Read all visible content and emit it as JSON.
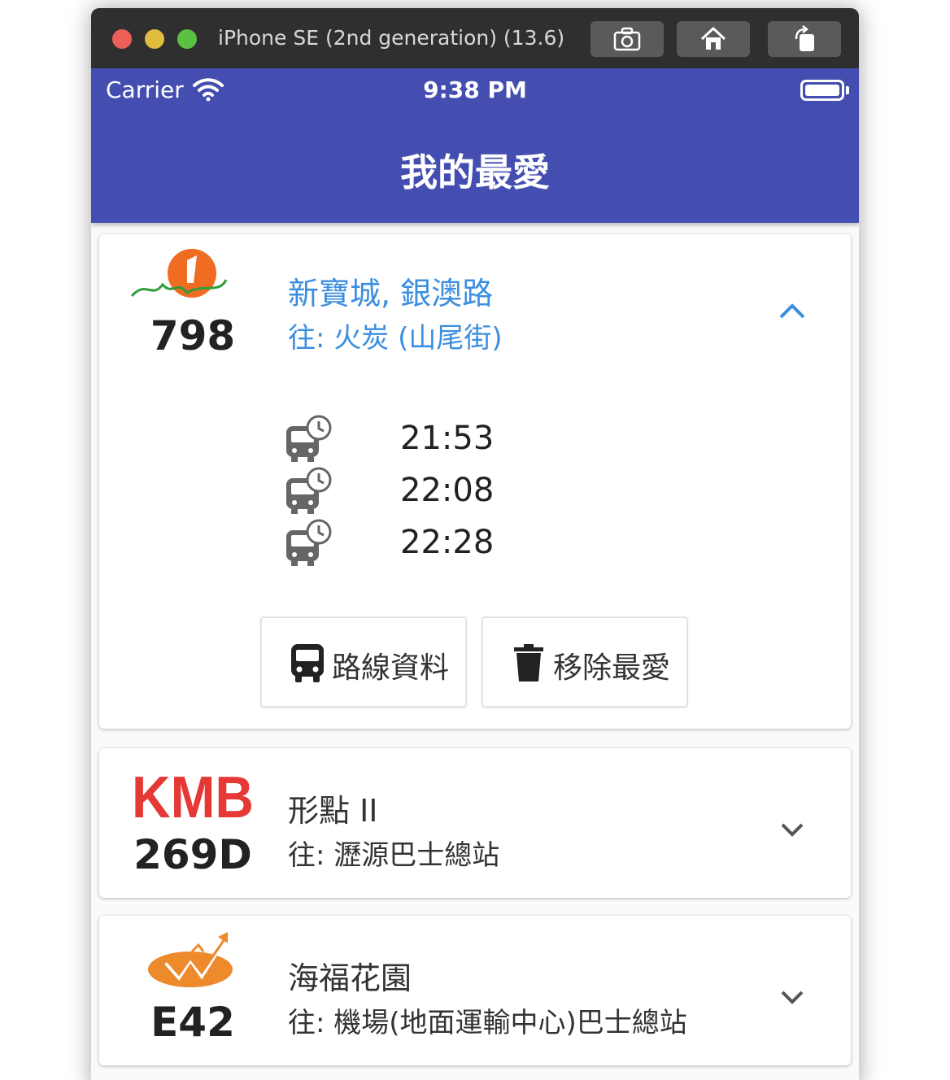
{
  "simulator": {
    "title": "iPhone SE (2nd generation) (13.6)",
    "toolbar_icons": [
      "screenshot-icon",
      "home-icon",
      "rotate-icon"
    ]
  },
  "status_bar": {
    "carrier": "Carrier",
    "time": "9:38 PM"
  },
  "header": {
    "title": "我的最愛"
  },
  "colors": {
    "app_bar": "#444eb0",
    "link_blue": "#3b8ee0",
    "kmb_red": "#e53935",
    "citybus_orange": "#ef6c22",
    "airport_orange": "#ec8a2c"
  },
  "favorites": [
    {
      "company_logo": "citybus-logo",
      "route": "798",
      "stop": "新寶城, 銀澳路",
      "destination": "往: 火炭 (山尾街)",
      "expanded": true,
      "etas": [
        "21:53",
        "22:08",
        "22:28"
      ],
      "actions": {
        "route_info": "路線資料",
        "remove": "移除最愛"
      }
    },
    {
      "company_logo": "kmb-logo",
      "logo_text": "KMB",
      "route": "269D",
      "stop": "形點 II",
      "destination": "往: 瀝源巴士總站",
      "expanded": false
    },
    {
      "company_logo": "long-win-logo",
      "route": "E42",
      "stop": "海福花園",
      "destination": "往: 機場(地面運輸中心)巴士總站",
      "expanded": false
    }
  ]
}
